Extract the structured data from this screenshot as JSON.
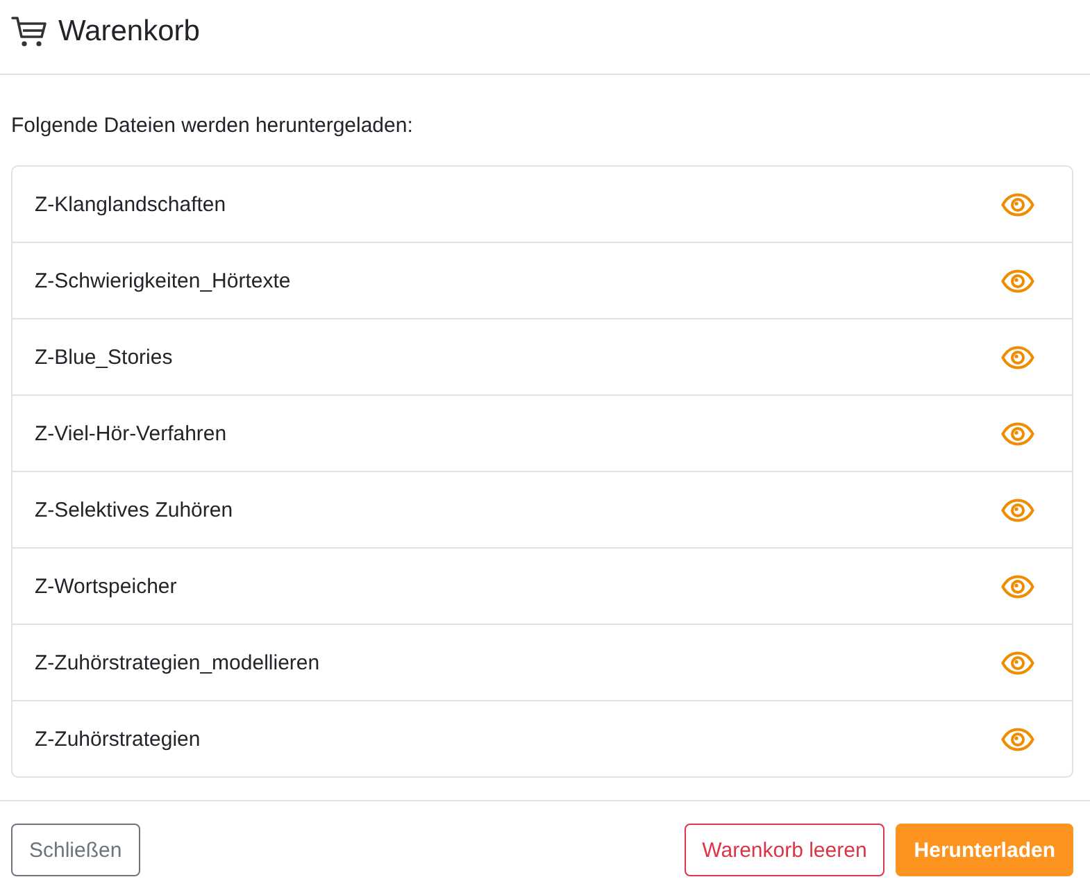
{
  "dialog": {
    "title": "Warenkorb"
  },
  "intro": "Folgende Dateien werden heruntergeladen:",
  "files": [
    {
      "name": "Z-Klanglandschaften"
    },
    {
      "name": "Z-Schwierigkeiten_Hörtexte"
    },
    {
      "name": "Z-Blue_Stories"
    },
    {
      "name": "Z-Viel-Hör-Verfahren"
    },
    {
      "name": "Z-Selektives Zuhören"
    },
    {
      "name": "Z-Wortspeicher"
    },
    {
      "name": "Z-Zuhörstrategien_modellieren"
    },
    {
      "name": "Z-Zuhörstrategien"
    }
  ],
  "footer": {
    "buttons": [
      {
        "label": "Schließen",
        "kind": "secondary"
      },
      {
        "label": "Warenkorb leeren",
        "kind": "danger"
      },
      {
        "label": "Herunterladen",
        "kind": "primary"
      }
    ]
  }
}
